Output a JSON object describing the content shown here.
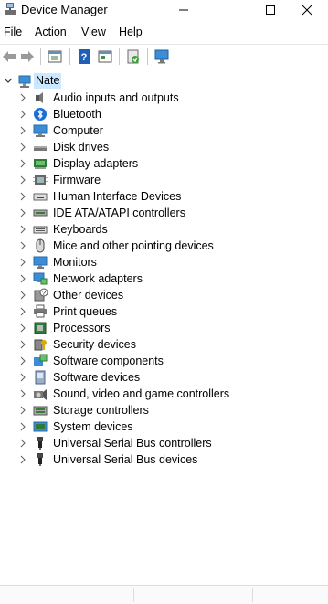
{
  "window": {
    "title": "Device Manager"
  },
  "menu": {
    "file": "File",
    "action": "Action",
    "view": "View",
    "help": "Help"
  },
  "toolbar": {
    "buttons": [
      "back-icon",
      "forward-icon",
      "properties-icon",
      "help-icon",
      "show-hidden-icon",
      "update-driver-icon",
      "scan-hardware-icon"
    ]
  },
  "tree": {
    "root": "Nate",
    "items": [
      {
        "label": "Audio inputs and outputs",
        "icon": "speaker-icon"
      },
      {
        "label": "Bluetooth",
        "icon": "bluetooth-icon"
      },
      {
        "label": "Computer",
        "icon": "computer-icon"
      },
      {
        "label": "Disk drives",
        "icon": "disk-drive-icon"
      },
      {
        "label": "Display adapters",
        "icon": "display-adapter-icon"
      },
      {
        "label": "Firmware",
        "icon": "firmware-icon"
      },
      {
        "label": "Human Interface Devices",
        "icon": "hid-icon"
      },
      {
        "label": "IDE ATA/ATAPI controllers",
        "icon": "ide-controller-icon"
      },
      {
        "label": "Keyboards",
        "icon": "keyboard-icon"
      },
      {
        "label": "Mice and other pointing devices",
        "icon": "mouse-icon"
      },
      {
        "label": "Monitors",
        "icon": "monitor-icon"
      },
      {
        "label": "Network adapters",
        "icon": "network-adapter-icon"
      },
      {
        "label": "Other devices",
        "icon": "unknown-device-icon"
      },
      {
        "label": "Print queues",
        "icon": "printer-icon"
      },
      {
        "label": "Processors",
        "icon": "processor-icon"
      },
      {
        "label": "Security devices",
        "icon": "security-device-icon"
      },
      {
        "label": "Software components",
        "icon": "software-component-icon"
      },
      {
        "label": "Software devices",
        "icon": "software-device-icon"
      },
      {
        "label": "Sound, video and game controllers",
        "icon": "sound-controller-icon"
      },
      {
        "label": "Storage controllers",
        "icon": "storage-controller-icon"
      },
      {
        "label": "System devices",
        "icon": "system-device-icon"
      },
      {
        "label": "Universal Serial Bus controllers",
        "icon": "usb-icon"
      },
      {
        "label": "Universal Serial Bus devices",
        "icon": "usb-icon"
      }
    ]
  },
  "colors": {
    "selection": "#cce8ff",
    "accent": "#0078d4"
  }
}
